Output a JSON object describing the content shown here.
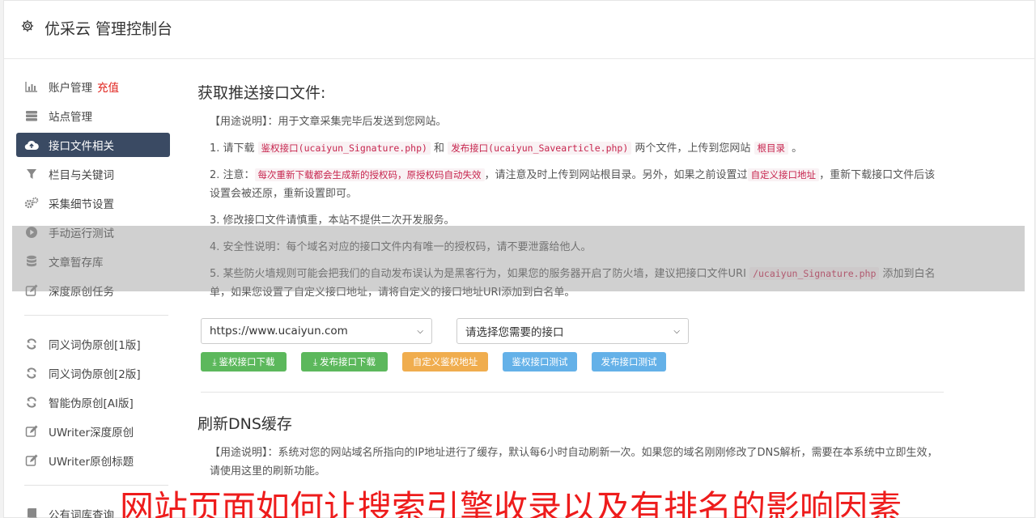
{
  "app": {
    "title": "优采云 管理控制台"
  },
  "sidebar": {
    "items": [
      {
        "label": "账户管理",
        "extra": "充值",
        "icon": "bar-chart-icon"
      },
      {
        "label": "站点管理",
        "icon": "server-icon"
      },
      {
        "label": "接口文件相关",
        "icon": "cloud-upload-icon",
        "active": true
      },
      {
        "label": "栏目与关键词",
        "icon": "filter-icon"
      },
      {
        "label": "采集细节设置",
        "icon": "gears-icon"
      },
      {
        "label": "手动运行测试",
        "icon": "play-circle-icon"
      },
      {
        "label": "文章暂存库",
        "icon": "database-icon"
      },
      {
        "label": "深度原创任务",
        "icon": "edit-icon"
      }
    ],
    "items2": [
      {
        "label": "同义词伪原创[1版]",
        "icon": "refresh-icon"
      },
      {
        "label": "同义词伪原创[2版]",
        "icon": "refresh-icon"
      },
      {
        "label": "智能伪原创[AI版]",
        "icon": "refresh-icon"
      },
      {
        "label": "UWriter深度原创",
        "icon": "edit-icon"
      },
      {
        "label": "UWriter原创标题",
        "icon": "edit-icon"
      }
    ],
    "items3": [
      {
        "label": "公有词库查询",
        "icon": "book-icon"
      }
    ]
  },
  "section1": {
    "title": "获取推送接口文件:",
    "usage_tag": "【用途说明】",
    "usage_text": "：用于文章采集完毕后发送到您网站。",
    "p1": {
      "prefix": "1. 请下载 ",
      "code1": "鉴权接口(ucaiyun_Signature.php)",
      "mid": " 和 ",
      "code2": "发布接口(ucaiyun_Savearticle.php)",
      "suffix": " 两个文件，上传到您网站 ",
      "code3": "根目录",
      "end": " 。"
    },
    "p2": {
      "prefix": "2. 注意：",
      "code1": "每次重新下载都会生成新的授权码，原授权码自动失效",
      "mid": "，请注意及时上传到网站根目录。另外，如果之前设置过",
      "code2": "自定义接口地址",
      "suffix": "，重新下载接口文件后该设置会被还原，重新设置即可。"
    },
    "p3": "3. 修改接口文件请慎重，本站不提供二次开发服务。",
    "p4": "4. 安全性说明：每个域名对应的接口文件内有唯一的授权码，请不要泄露给他人。",
    "p5": {
      "prefix": "5. 某些防火墙规则可能会把我们的自动发布误认为是黑客行为，如果您的服务器开启了防火墙，建议把接口文件URI ",
      "code1": "/ucaiyun_Signature.php",
      "suffix": " 添加到白名单，如果您设置了自定义接口地址，请将自定义的接口地址URI添加到白名单。"
    },
    "site_select": "https://www.ucaiyun.com",
    "interface_select": "请选择您需要的接口",
    "buttons": {
      "auth_download": "鉴权接口下载",
      "publish_download": "发布接口下载",
      "custom_auth": "自定义鉴权地址",
      "auth_test": "鉴权接口测试",
      "publish_test": "发布接口测试"
    }
  },
  "section2": {
    "title": "刷新DNS缓存",
    "usage_tag": "【用途说明】",
    "usage_text": "：系统对您的网站域名所指向的IP地址进行了缓存，默认每6小时自动刷新一次。如果您的域名刚刚修改了DNS解析，需要在本系统中立即生效，请使用这里的刷新功能。"
  },
  "overlay": {
    "watermark": "网站页面如何让搜索引擎收录以及有排名的影响因素"
  },
  "colors": {
    "active_nav": "#3a4a63",
    "green_btn": "#5cb85c",
    "orange_btn": "#f0ad4e",
    "blue_btn": "#64b1e8",
    "watermark": "#ee1c1c"
  }
}
